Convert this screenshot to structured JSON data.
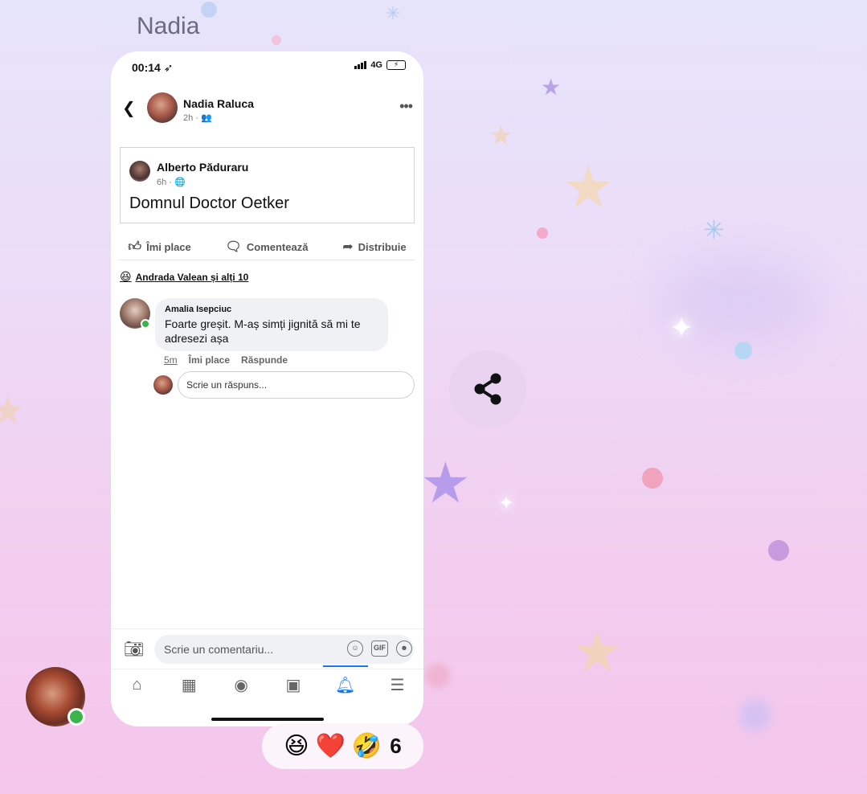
{
  "sender": {
    "name": "Nadia"
  },
  "screenshot": {
    "status": {
      "time": "00:14",
      "network": "4G"
    },
    "post": {
      "poster_name": "Nadia Raluca",
      "poster_meta": "2h ·",
      "shared": {
        "author": "Alberto Păduraru",
        "meta": "6h ·",
        "text": "Domnul Doctor Oetker"
      },
      "actions": {
        "like": "Îmi place",
        "comment": "Comentează",
        "share": "Distribuie"
      },
      "reactors": "Andrada Valean și alți 10",
      "comment": {
        "author": "Amalia Isepciuc",
        "text": "Foarte greșit. M-aș simți jignită să mi te adresezi așa",
        "time": "5m",
        "like": "Îmi place",
        "reply": "Răspunde"
      },
      "reply_placeholder": "Scrie un răspuns...",
      "comment_placeholder": "Scrie un comentariu..."
    }
  },
  "reactions": {
    "count": "6",
    "emojis": [
      "laughing",
      "heart",
      "rofl"
    ]
  },
  "colors": {
    "online": "#3bb54a",
    "facebook_blue": "#1877f2"
  },
  "icons": [
    "back-icon",
    "more-icon",
    "globe-icon",
    "friends-icon",
    "like-icon",
    "comment-icon",
    "share-icon",
    "camera-icon",
    "sticker-icon",
    "gif-icon",
    "emoji-icon",
    "home-icon",
    "marketplace-icon",
    "groups-icon",
    "pages-icon",
    "notifications-icon",
    "menu-icon"
  ]
}
